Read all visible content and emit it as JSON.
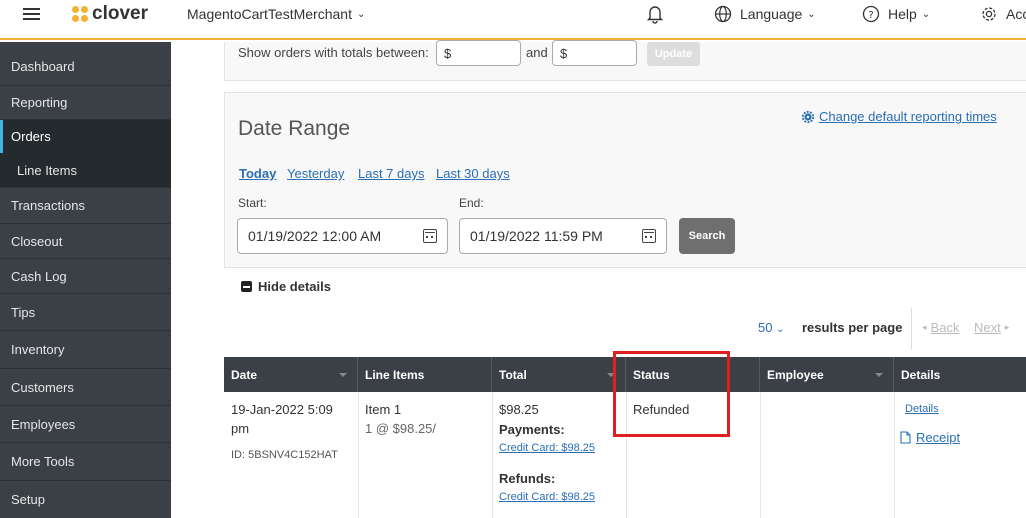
{
  "topbar": {
    "logo_text": "clover",
    "merchant": "MagentoCartTestMerchant",
    "language_label": "Language",
    "help_label": "Help",
    "account_label": "Acc",
    "brand_color": "#f2b134"
  },
  "sidebar": {
    "items": [
      {
        "label": "Dashboard"
      },
      {
        "label": "Reporting"
      },
      {
        "label": "Orders"
      },
      {
        "label": "Line Items"
      },
      {
        "label": "Transactions"
      },
      {
        "label": "Closeout"
      },
      {
        "label": "Cash Log"
      },
      {
        "label": "Tips"
      },
      {
        "label": "Inventory"
      },
      {
        "label": "Customers"
      },
      {
        "label": "Employees"
      },
      {
        "label": "More Tools"
      },
      {
        "label": "Setup"
      }
    ],
    "active": "Orders"
  },
  "totals_filter": {
    "label": "Show orders with totals between:",
    "min_value": "$",
    "and_label": "and",
    "max_value": "$",
    "update_label": "Update"
  },
  "date_range": {
    "title": "Date Range",
    "change_times_link": "Change default reporting times",
    "quick_links": [
      "Today",
      "Yesterday",
      "Last 7 days",
      "Last 30 days"
    ],
    "start_label": "Start:",
    "start_value": "01/19/2022 12:00 AM",
    "end_label": "End:",
    "end_value": "01/19/2022 11:59 PM",
    "search_label": "Search"
  },
  "details_toggle": "Hide details",
  "pagination": {
    "per_page": "50",
    "per_page_label": "results per page",
    "back_label": "Back",
    "next_label": "Next"
  },
  "table": {
    "headers": [
      "Date",
      "Line Items",
      "Total",
      "Status",
      "Employee",
      "Details"
    ],
    "row": {
      "date_line1": "19-Jan-2022 5:09",
      "date_line2": "pm",
      "id": "ID: 5BSNV4C152HAT",
      "item_name": "Item 1",
      "item_detail": "1 @ $98.25/",
      "total": "$98.25",
      "payments_label": "Payments:",
      "payment_link": "Credit Card: $98.25",
      "refunds_label": "Refunds:",
      "refund_link": "Credit Card: $98.25",
      "status": "Refunded",
      "details_link": "Details",
      "receipt_link": "Receipt"
    }
  },
  "colors": {
    "sidebar_bg": "#3a4045",
    "header_bg": "#3a4045",
    "link": "#2a6eb3",
    "highlight": "#e02020"
  }
}
